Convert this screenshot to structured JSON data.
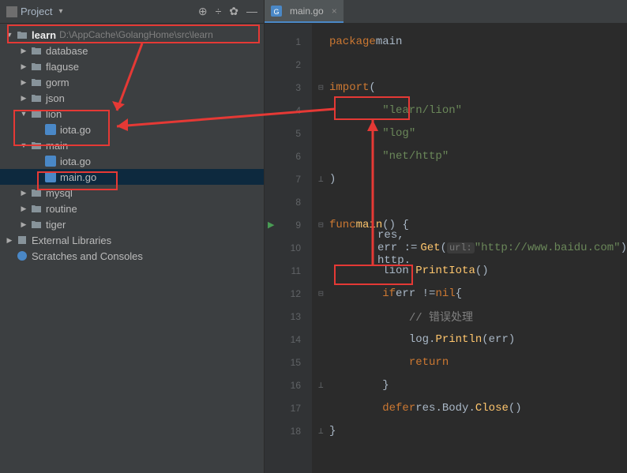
{
  "sidebar": {
    "title": "Project",
    "root": {
      "name": "learn",
      "path": "D:\\AppCache\\GolangHome\\src\\learn"
    },
    "items": [
      {
        "label": "database",
        "type": "folder"
      },
      {
        "label": "flaguse",
        "type": "folder"
      },
      {
        "label": "gorm",
        "type": "folder"
      },
      {
        "label": "json",
        "type": "folder"
      },
      {
        "label": "lion",
        "type": "folder",
        "expanded": true,
        "children": [
          {
            "label": "iota.go",
            "type": "gofile"
          }
        ]
      },
      {
        "label": "main",
        "type": "folder",
        "expanded": true,
        "children": [
          {
            "label": "iota.go",
            "type": "gofile"
          },
          {
            "label": "main.go",
            "type": "gofile",
            "selected": true
          }
        ]
      },
      {
        "label": "mysql",
        "type": "folder"
      },
      {
        "label": "routine",
        "type": "folder"
      },
      {
        "label": "tiger",
        "type": "folder"
      }
    ],
    "extras": [
      {
        "label": "External Libraries"
      },
      {
        "label": "Scratches and Consoles"
      }
    ]
  },
  "tab": {
    "filename": "main.go"
  },
  "code": {
    "lines": [
      {
        "num": "1",
        "tokens": [
          {
            "t": "kw",
            "v": "package "
          },
          {
            "t": "ident",
            "v": "main"
          }
        ]
      },
      {
        "num": "2",
        "tokens": []
      },
      {
        "num": "3",
        "fold": "open",
        "tokens": [
          {
            "t": "kw",
            "v": "import "
          },
          {
            "t": "ident",
            "v": "("
          }
        ]
      },
      {
        "num": "4",
        "indent": 2,
        "tokens": [
          {
            "t": "str",
            "v": "\"learn/lion\""
          }
        ]
      },
      {
        "num": "5",
        "indent": 2,
        "tokens": [
          {
            "t": "str",
            "v": "\"log\""
          }
        ]
      },
      {
        "num": "6",
        "indent": 2,
        "tokens": [
          {
            "t": "str",
            "v": "\"net/http\""
          }
        ]
      },
      {
        "num": "7",
        "fold": "close",
        "tokens": [
          {
            "t": "ident",
            "v": ")"
          }
        ]
      },
      {
        "num": "8",
        "tokens": []
      },
      {
        "num": "9",
        "run": true,
        "fold": "open",
        "tokens": [
          {
            "t": "kw",
            "v": "func "
          },
          {
            "t": "func-name",
            "v": "main"
          },
          {
            "t": "ident",
            "v": "() {"
          }
        ]
      },
      {
        "num": "10",
        "indent": 2,
        "tokens": [
          {
            "t": "ident",
            "v": "res, err := http."
          },
          {
            "t": "func-name",
            "v": "Get"
          },
          {
            "t": "ident",
            "v": "( "
          },
          {
            "t": "param-hint",
            "v": "url:"
          },
          {
            "t": "ident",
            "v": " "
          },
          {
            "t": "str",
            "v": "\"http://www.baidu.com\""
          },
          {
            "t": "ident",
            "v": ")"
          }
        ]
      },
      {
        "num": "11",
        "indent": 2,
        "tokens": [
          {
            "t": "ident",
            "v": "lion."
          },
          {
            "t": "func-name",
            "v": "PrintIota"
          },
          {
            "t": "ident",
            "v": "()"
          }
        ]
      },
      {
        "num": "12",
        "fold": "open",
        "indent": 2,
        "tokens": [
          {
            "t": "kw",
            "v": "if "
          },
          {
            "t": "ident",
            "v": "err != "
          },
          {
            "t": "kw",
            "v": "nil "
          },
          {
            "t": "ident",
            "v": "{"
          }
        ]
      },
      {
        "num": "13",
        "indent": 3,
        "tokens": [
          {
            "t": "comment",
            "v": "// 错误处理"
          }
        ]
      },
      {
        "num": "14",
        "indent": 3,
        "tokens": [
          {
            "t": "ident",
            "v": "log."
          },
          {
            "t": "func-name",
            "v": "Println"
          },
          {
            "t": "ident",
            "v": "(err)"
          }
        ]
      },
      {
        "num": "15",
        "indent": 3,
        "tokens": [
          {
            "t": "kw",
            "v": "return"
          }
        ]
      },
      {
        "num": "16",
        "fold": "close",
        "indent": 2,
        "tokens": [
          {
            "t": "ident",
            "v": "}"
          }
        ]
      },
      {
        "num": "17",
        "indent": 2,
        "tokens": [
          {
            "t": "kw",
            "v": "defer "
          },
          {
            "t": "ident",
            "v": "res.Body."
          },
          {
            "t": "func-name",
            "v": "Close"
          },
          {
            "t": "ident",
            "v": "()"
          }
        ]
      },
      {
        "num": "18",
        "fold": "close",
        "tokens": [
          {
            "t": "ident",
            "v": "}"
          }
        ]
      }
    ]
  }
}
